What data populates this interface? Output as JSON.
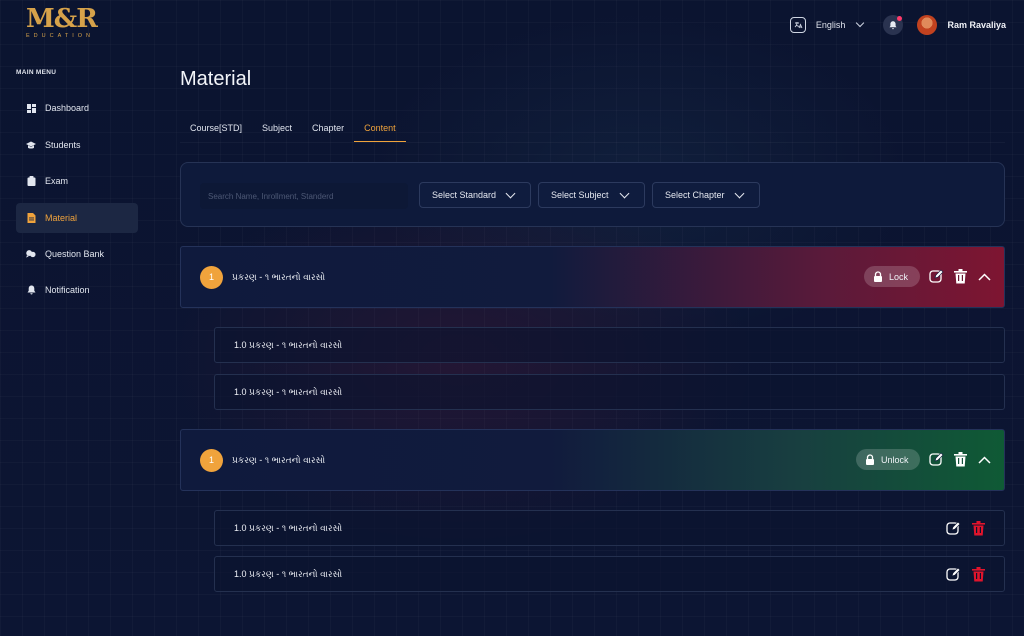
{
  "brand": {
    "logo_main": "M&R",
    "logo_sub": "EDUCATION"
  },
  "topbar": {
    "language_icon": "translate-icon",
    "language": "English",
    "notification_icon": "bell-icon",
    "username": "Ram Ravaliya"
  },
  "sidebar": {
    "title": "MAIN MENU",
    "items": [
      {
        "label": "Dashboard",
        "icon": "dashboard-icon",
        "active": false
      },
      {
        "label": "Students",
        "icon": "graduation-cap-icon",
        "active": false
      },
      {
        "label": "Exam",
        "icon": "clipboard-icon",
        "active": false
      },
      {
        "label": "Material",
        "icon": "document-icon",
        "active": true
      },
      {
        "label": "Question Bank",
        "icon": "chat-bubbles-icon",
        "active": false
      },
      {
        "label": "Notification",
        "icon": "bell-icon",
        "active": false
      }
    ]
  },
  "page": {
    "title": "Material"
  },
  "tabs": [
    {
      "label": "Course[STD]",
      "active": false
    },
    {
      "label": "Subject",
      "active": false
    },
    {
      "label": "Chapter",
      "active": false
    },
    {
      "label": "Content",
      "active": true
    }
  ],
  "filters": {
    "search_placeholder": "Search Name, Inrollment, Standerd",
    "standard": "Select Standard",
    "subject": "Select Subject",
    "chapter": "Select Chapter"
  },
  "chapters": [
    {
      "number": "1",
      "title": "પ્રકરણ - ૧  ભારતનો વારસો",
      "status_label": "Lock",
      "accent": "#7e1531",
      "rows": [
        {
          "label": "1.0 પ્રકરણ - ૧  ભારતનો વારસો"
        },
        {
          "label": "1.0 પ્રકરણ - ૧  ભારતનો વારસો"
        }
      ]
    },
    {
      "number": "1",
      "title": "પ્રકરણ - ૧  ભારતનો વારસો",
      "status_label": "Unlock",
      "accent": "#0f5a35",
      "rows": [
        {
          "label": "1.0 પ્રકરણ - ૧  ભારતનો વારસો"
        },
        {
          "label": "1.0 પ્રકરણ - ૧  ભારતનો વારસો"
        }
      ]
    }
  ],
  "colors": {
    "accent": "#f0a33c",
    "background": "#0b1430",
    "delete": "#e0142c"
  }
}
